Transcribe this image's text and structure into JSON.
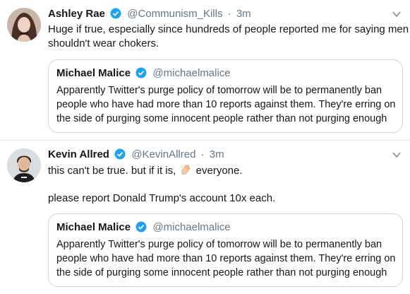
{
  "tweets": [
    {
      "name": "Ashley Rae",
      "handle": "@Communism_Kills",
      "separator": "·",
      "time": "3m",
      "text_lines": [
        "Huge if true, especially since hundreds of people reported me for saying men",
        "shouldn't wear chokers."
      ],
      "quote": {
        "name": "Michael Malice",
        "handle": "@michaelmalice",
        "lines": [
          "Apparently Twitter's purge policy of tomorrow will be to permanently ban",
          "people who have had more than 10 reports against them. They're erring on",
          "the side of purging some innocent people rather than not purging enough"
        ]
      }
    },
    {
      "name": "Kevin Allred",
      "handle": "@KevinAllred",
      "separator": "·",
      "time": "3m",
      "line1_before": "this can't be true. but if it is,",
      "line1_after": "everyone.",
      "line2": "please report Donald Trump's account 10x each.",
      "quote": {
        "name": "Michael Malice",
        "handle": "@michaelmalice",
        "lines": [
          "Apparently Twitter's purge policy of tomorrow will be to permanently ban",
          "people who have had more than 10 reports against them. They're erring on",
          "the side of purging some innocent people rather than not purging enough"
        ]
      }
    }
  ],
  "icons": {
    "verified": "verified-badge-icon",
    "caret": "chevron-down-icon",
    "clap": "clapping-hands-icon"
  },
  "colors": {
    "verified_blue": "#1da1f2",
    "secondary_text": "#657786",
    "border": "#e6ecf0"
  }
}
